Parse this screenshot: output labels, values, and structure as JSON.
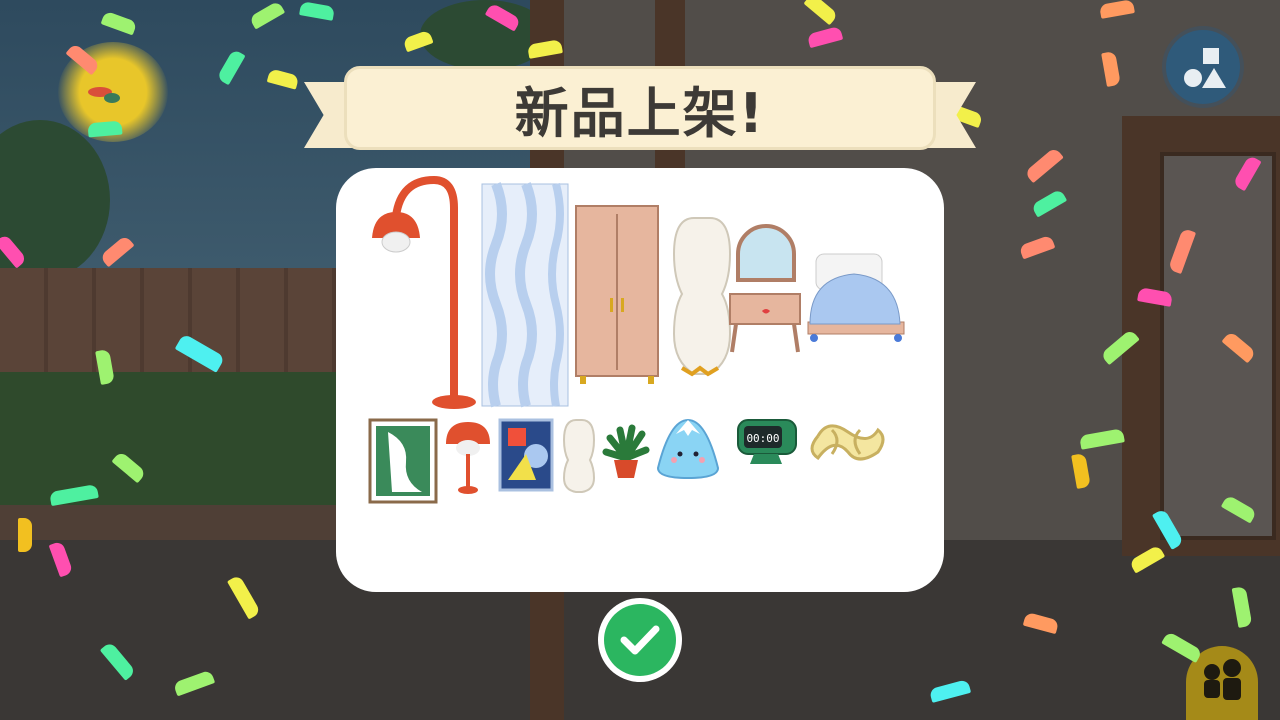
{
  "banner": {
    "title": "新品上架!"
  },
  "icons": {
    "shape_button": "shapes-icon",
    "confirm_button": "checkmark-icon",
    "characters_button": "characters-icon"
  },
  "colors": {
    "banner_bg": "#fbf0d3",
    "panel_bg": "#ffffff",
    "confirm_green": "#2bb660",
    "shape_button_bg": "#2f5a7a"
  },
  "new_items": {
    "row1": [
      "floor-lamp",
      "curtain",
      "wardrobe",
      "paper-lantern",
      "vanity-mirror",
      "bed"
    ],
    "row2": [
      "framed-painting",
      "table-lamp",
      "abstract-poster",
      "small-paper-lantern",
      "potted-plant",
      "mountain-plush",
      "digital-clock",
      "knot-pillow"
    ]
  }
}
